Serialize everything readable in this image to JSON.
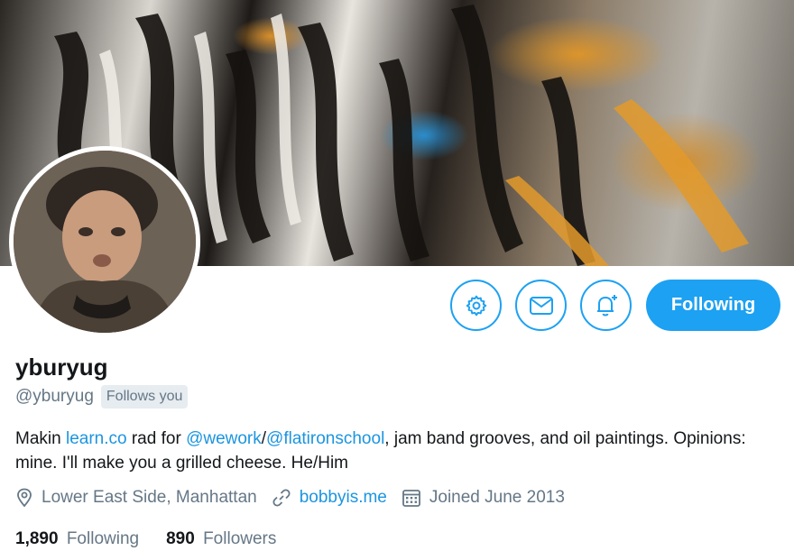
{
  "profile": {
    "display_name": "yburyug",
    "handle": "@yburyug",
    "follows_you_badge": "Follows you"
  },
  "actions": {
    "settings_icon": "gear-icon",
    "message_icon": "envelope-icon",
    "notify_icon": "bell-plus-icon",
    "follow_label": "Following"
  },
  "bio": {
    "part1": "Makin ",
    "link1": "learn.co",
    "part2": " rad for ",
    "mention1": "@wework",
    "sep": "/",
    "mention2": "@flatironschool",
    "part3": ", jam band grooves, and oil paintings. Opinions: mine. I'll make you a grilled cheese. He/Him"
  },
  "meta": {
    "location": "Lower East Side, Manhattan",
    "website": "bobbyis.me",
    "joined": "Joined June 2013"
  },
  "stats": {
    "following_count": "1,890",
    "following_label": "Following",
    "followers_count": "890",
    "followers_label": "Followers"
  },
  "colors": {
    "accent": "#1da1f2",
    "link": "#1b95e0",
    "secondary_text": "#657786"
  }
}
